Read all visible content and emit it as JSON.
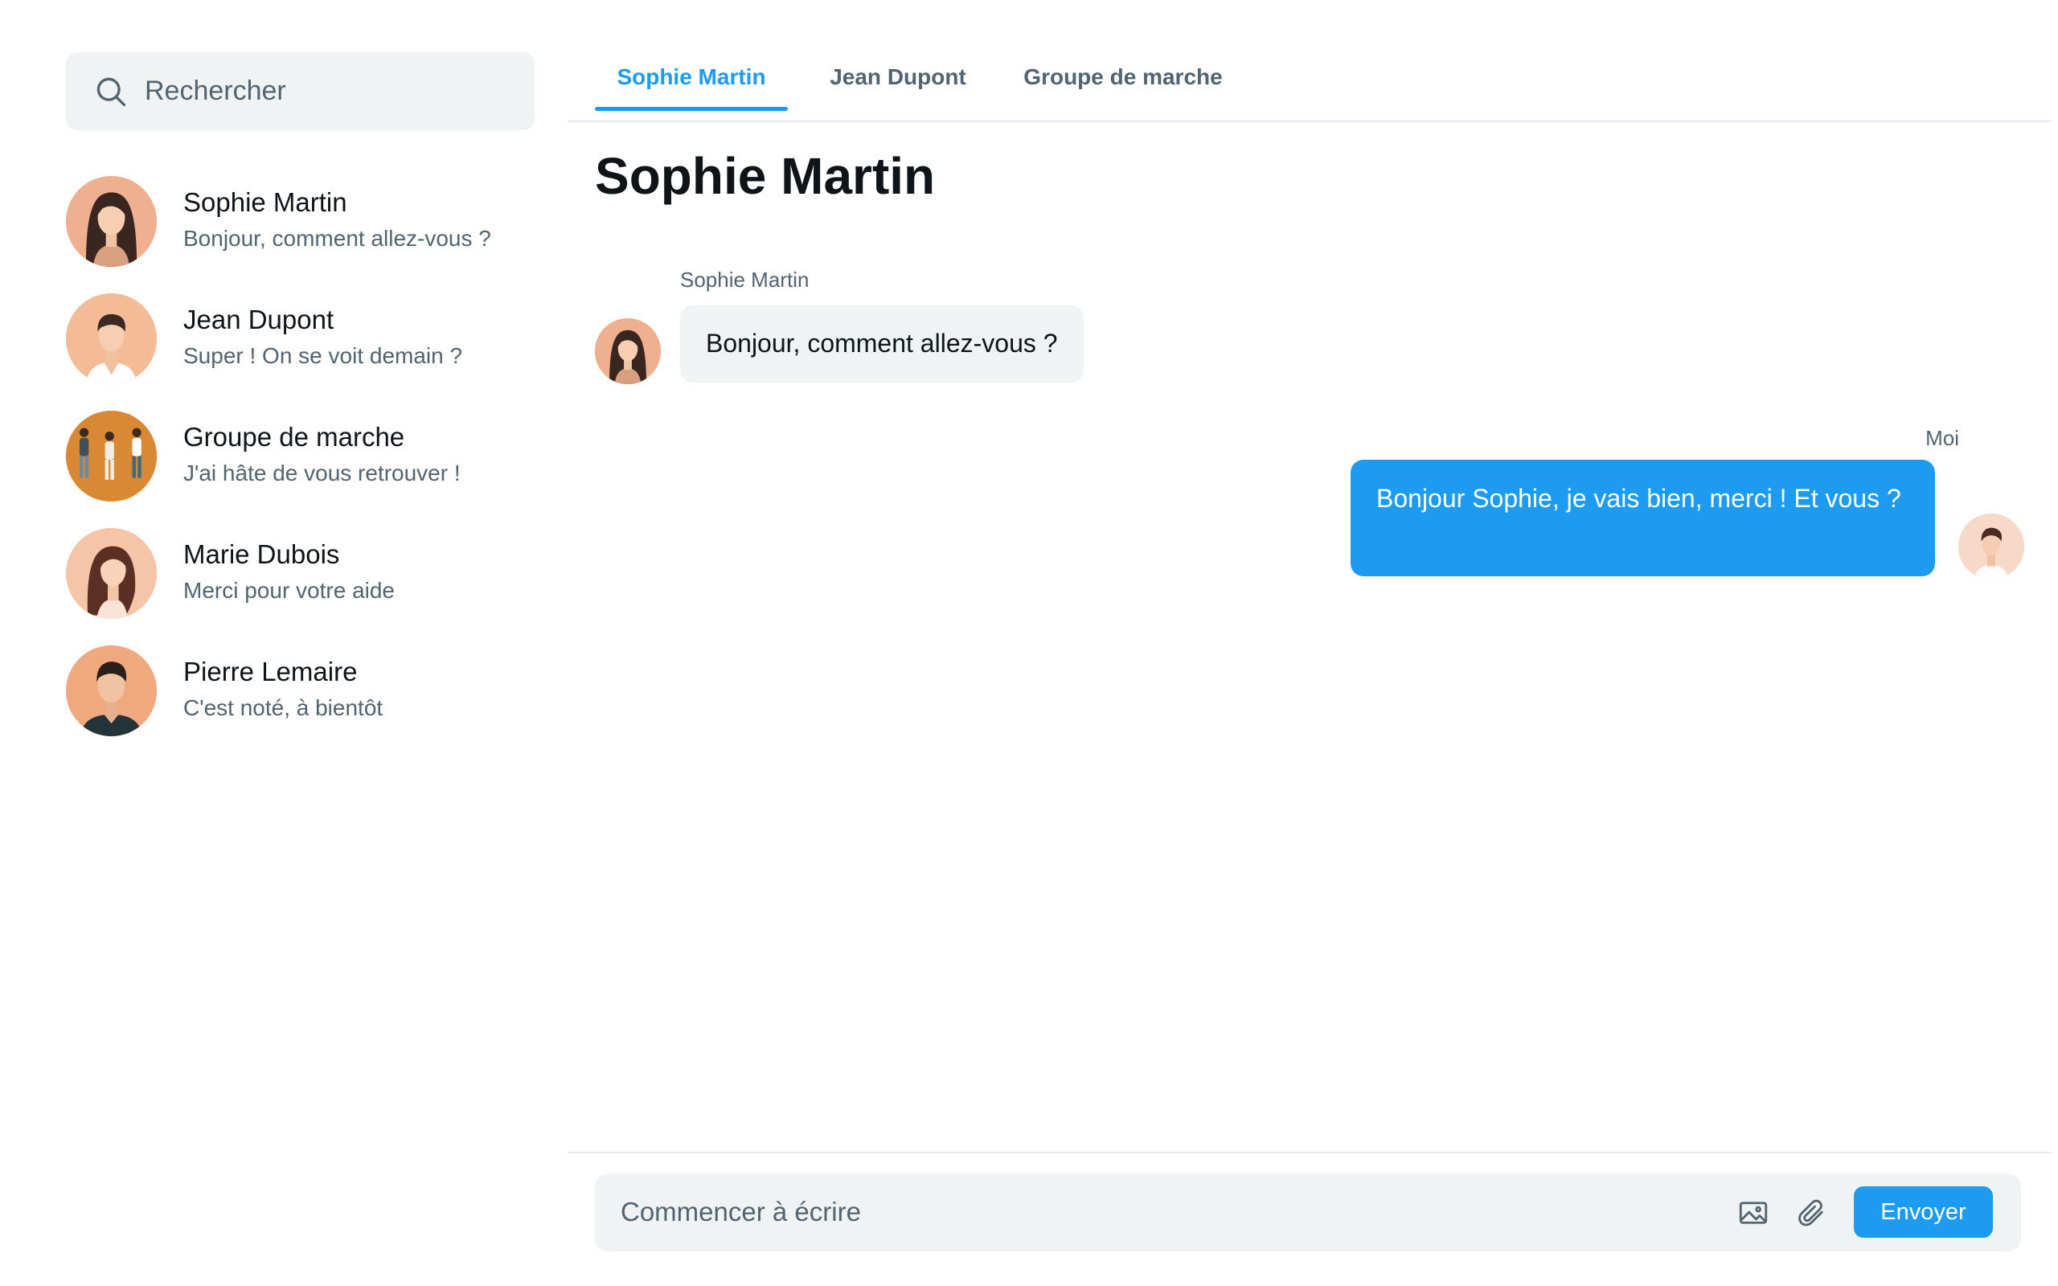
{
  "search": {
    "placeholder": "Rechercher",
    "icon": "search-icon"
  },
  "contacts": [
    {
      "name": "Sophie Martin",
      "preview": "Bonjour, comment allez-vous ?",
      "avatar": "woman-avatar"
    },
    {
      "name": "Jean Dupont",
      "preview": "Super ! On se voit demain ?",
      "avatar": "man-avatar"
    },
    {
      "name": "Groupe de marche",
      "preview": "J'ai hâte de vous retrouver !",
      "avatar": "group-avatar"
    },
    {
      "name": "Marie Dubois",
      "preview": "Merci pour votre aide",
      "avatar": "woman-avatar"
    },
    {
      "name": "Pierre Lemaire",
      "preview": "C'est noté, à bientôt",
      "avatar": "man-avatar"
    }
  ],
  "tabs": [
    {
      "label": "Sophie Martin",
      "active": true
    },
    {
      "label": "Jean Dupont",
      "active": false
    },
    {
      "label": "Groupe de marche",
      "active": false
    }
  ],
  "chat": {
    "title": "Sophie Martin",
    "messages": [
      {
        "sender": "Sophie Martin",
        "text": "Bonjour, comment allez-vous ?",
        "direction": "incoming"
      },
      {
        "sender": "Moi",
        "text": "Bonjour Sophie, je vais bien, merci ! Et vous ?",
        "direction": "outgoing"
      }
    ]
  },
  "composer": {
    "placeholder": "Commencer à écrire",
    "send_label": "Envoyer",
    "icons": [
      "image-icon",
      "paperclip-icon"
    ]
  },
  "colors": {
    "accent": "#1d9bf0",
    "muted_text": "#536471",
    "surface": "#eff3f4",
    "divider": "#e6ecf0"
  }
}
